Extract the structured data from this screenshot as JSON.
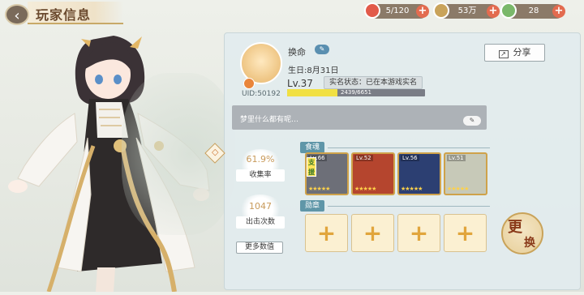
{
  "header": {
    "back_icon": "chevron-left",
    "title": "玩家信息",
    "resources": [
      {
        "name": "stamina",
        "value": "5/120",
        "color": "#e25a4a"
      },
      {
        "name": "gold",
        "value": "53万",
        "color": "#c9a35a"
      },
      {
        "name": "gems",
        "value": "28",
        "color": "#7ab86a"
      }
    ]
  },
  "profile": {
    "nickname": "换命",
    "birthday": "生日:8月31日",
    "level": "Lv.37",
    "realname_status": "实名状态：已在本游戏实名",
    "uid": "UID:50192",
    "exp_text": "2439/6651",
    "exp_fraction": 0.367,
    "share_label": "分享",
    "signature": "梦里什么都有呢…"
  },
  "stats": {
    "collection_rate": "61.9%",
    "collection_label": "收集率",
    "sortie_count": "1047",
    "sortie_label": "出击次数",
    "more_label": "更多数值"
  },
  "sections": {
    "food_souls": "食魂",
    "medals": "勋章",
    "support_tag": "支援"
  },
  "food_souls": [
    {
      "level": "Lv.66",
      "color": "#6d6f78"
    },
    {
      "level": "Lv.52",
      "color": "#b5452e"
    },
    {
      "level": "Lv.56",
      "color": "#2c3f72"
    },
    {
      "level": "Lv.51",
      "color": "#c7c9b8"
    }
  ],
  "medal_slots": [
    "+",
    "+",
    "+",
    "+"
  ],
  "swap_button": {
    "line1": "更",
    "line2": "换"
  },
  "edit_icon_text": "✎"
}
